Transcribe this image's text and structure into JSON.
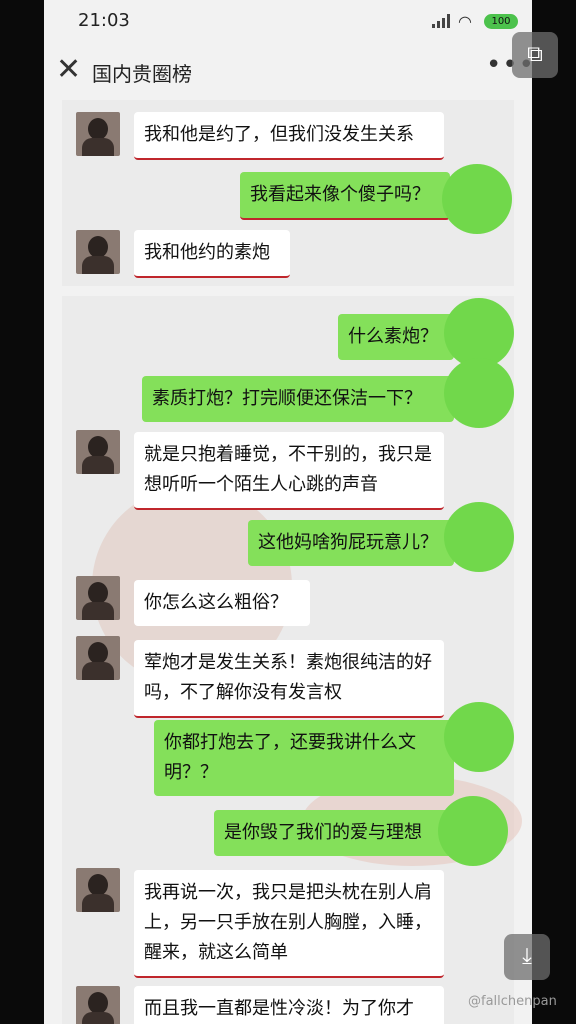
{
  "status": {
    "time": "21:03",
    "battery": "100"
  },
  "header": {
    "title": "国内贵圈榜",
    "close_icon": "close-icon",
    "more_icon": "more-icon"
  },
  "messages": [
    {
      "side": "in",
      "text": "我和他是约了，但我们没发生关系"
    },
    {
      "side": "out",
      "text": "我看起来像个傻子吗？"
    },
    {
      "side": "in",
      "text": "我和他约的素炮"
    },
    {
      "side": "out",
      "text": "什么素炮？"
    },
    {
      "side": "out",
      "text": "素质打炮？打完顺便还保洁一下？"
    },
    {
      "side": "in",
      "text": "就是只抱着睡觉，不干别的，我只是想听听一个陌生人心跳的声音"
    },
    {
      "side": "out",
      "text": "这他妈啥狗屁玩意儿？"
    },
    {
      "side": "in",
      "text": "你怎么这么粗俗？"
    },
    {
      "side": "in",
      "text": "荤炮才是发生关系！素炮很纯洁的好吗，不了解你没有发言权"
    },
    {
      "side": "out",
      "text": "你都打炮去了，还要我讲什么文明？？"
    },
    {
      "side": "out",
      "text": "是你毁了我们的爱与理想"
    },
    {
      "side": "in",
      "text": "我再说一次，我只是把头枕在别人肩上，另一只手放在别人胸膛，入睡，醒来，就这么简单"
    },
    {
      "side": "in",
      "text": "而且我一直都是性冷淡！为了你才"
    }
  ],
  "overlay": {
    "window_icon": "multi-window-icon",
    "download_icon": "download-icon"
  },
  "watermark": "@fallchenpan",
  "colors": {
    "outgoing": "#84e05a",
    "underline": "#c0262c",
    "circle": "#71d84b"
  }
}
